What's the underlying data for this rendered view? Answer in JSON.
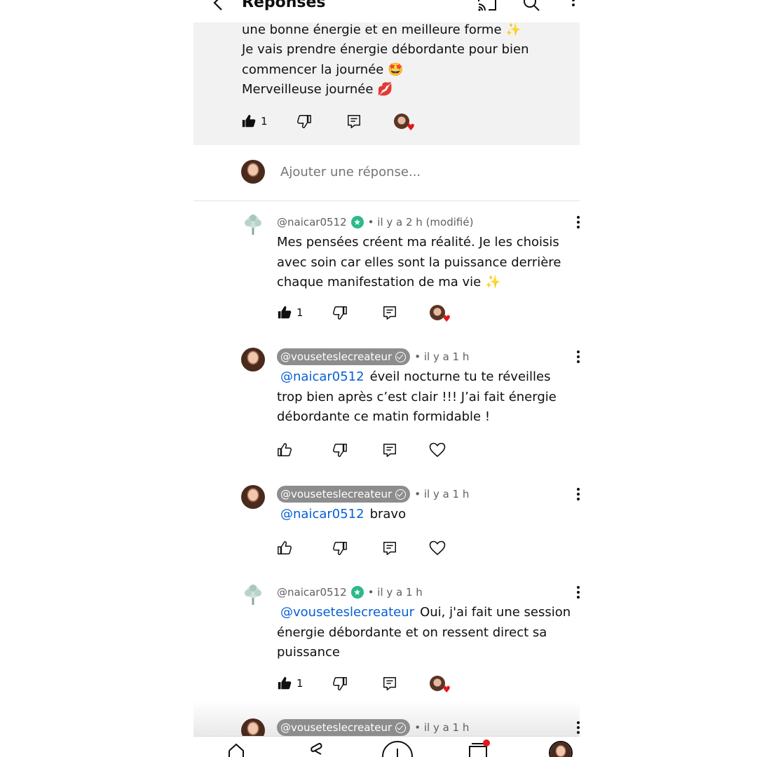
{
  "header": {
    "title": "Réponses"
  },
  "original_comment": {
    "lines": [
      "une bonne énergie et en meilleure forme ✨",
      "Je vais prendre énergie débordante pour bien",
      "commencer la journée 🤩",
      "Merveilleuse journée 💋"
    ],
    "likes": "1",
    "creator_hearted": true
  },
  "add_reply": {
    "placeholder": "Ajouter une réponse..."
  },
  "replies": [
    {
      "author": "@naicar0512",
      "time": "• il y a 2 h (modifié)",
      "lines": [
        "Mes pensées créent ma réalité. Je les choisis",
        "avec soin car elles sont la puissance derrière",
        "chaque manifestation de ma vie ✨"
      ],
      "likes": "1",
      "creator_hearted": true
    },
    {
      "author": "@vouseteslecreateur",
      "time": "• il y a 1 h",
      "mention": "@naicar0512",
      "lines": [
        "éveil nocturne tu te réveilles",
        "trop bien après c’est clair !!! J’ai fait énergie",
        "débordante ce matin formidable !"
      ]
    },
    {
      "author": "@vouseteslecreateur",
      "time": "• il y a 1 h",
      "mention": "@naicar0512",
      "lines": [
        "bravo"
      ]
    },
    {
      "author": "@naicar0512",
      "time": "• il y a 1 h",
      "mention": "@vouseteslecreateur",
      "lines": [
        "Oui, j'ai fait une session",
        "énergie débordante et on ressent direct sa",
        "puissance"
      ],
      "likes": "1",
      "creator_hearted": true
    },
    {
      "author": "@vouseteslecreateur",
      "time": "• il y a 1 h"
    }
  ],
  "icons": {
    "back": "arrow-left-icon",
    "cast": "cast-icon",
    "search": "search-icon",
    "more": "more-vertical-icon",
    "like": "thumb-up-icon",
    "dislike": "thumb-down-icon",
    "reply": "reply-icon",
    "heart": "heart-icon"
  },
  "colors": {
    "link": "#065fd4",
    "badge_green": "#2bb98c",
    "pill_grey": "#8d8d8d",
    "heart_red": "#e01818"
  }
}
